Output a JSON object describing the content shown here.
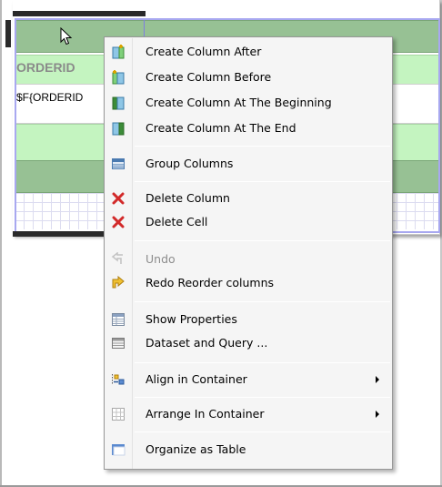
{
  "report": {
    "column_header": "ORDERID",
    "field_expression": "$F{ORDERID"
  },
  "context_menu": {
    "items": [
      {
        "label": "Create Column After",
        "icon": "column-after-icon",
        "enabled": true
      },
      {
        "label": "Create Column Before",
        "icon": "column-before-icon",
        "enabled": true
      },
      {
        "label": "Create Column At The Beginning",
        "icon": "column-beginning-icon",
        "enabled": true
      },
      {
        "label": "Create Column At The End",
        "icon": "column-end-icon",
        "enabled": true
      },
      {
        "label": "Group Columns",
        "icon": "group-columns-icon",
        "enabled": true
      },
      {
        "label": "Delete Column",
        "icon": "delete-icon",
        "enabled": true
      },
      {
        "label": "Delete Cell",
        "icon": "delete-icon",
        "enabled": true
      },
      {
        "label": "Undo",
        "icon": "undo-icon",
        "enabled": false
      },
      {
        "label": "Redo Reorder columns",
        "icon": "redo-icon",
        "enabled": true
      },
      {
        "label": "Show Properties",
        "icon": "properties-icon",
        "enabled": true
      },
      {
        "label": "Dataset and Query ...",
        "icon": "dataset-icon",
        "enabled": true
      },
      {
        "label": "Align in Container",
        "icon": "align-icon",
        "enabled": true,
        "submenu": true
      },
      {
        "label": "Arrange In Container",
        "icon": "arrange-icon",
        "enabled": true,
        "submenu": true
      },
      {
        "label": "Organize as Table",
        "icon": "table-icon",
        "enabled": true
      }
    ]
  },
  "colors": {
    "header_green": "#97c194",
    "row_green": "#c4f4c0",
    "selection_blue": "#a8a8f0",
    "delete_red": "#d22a2a"
  }
}
